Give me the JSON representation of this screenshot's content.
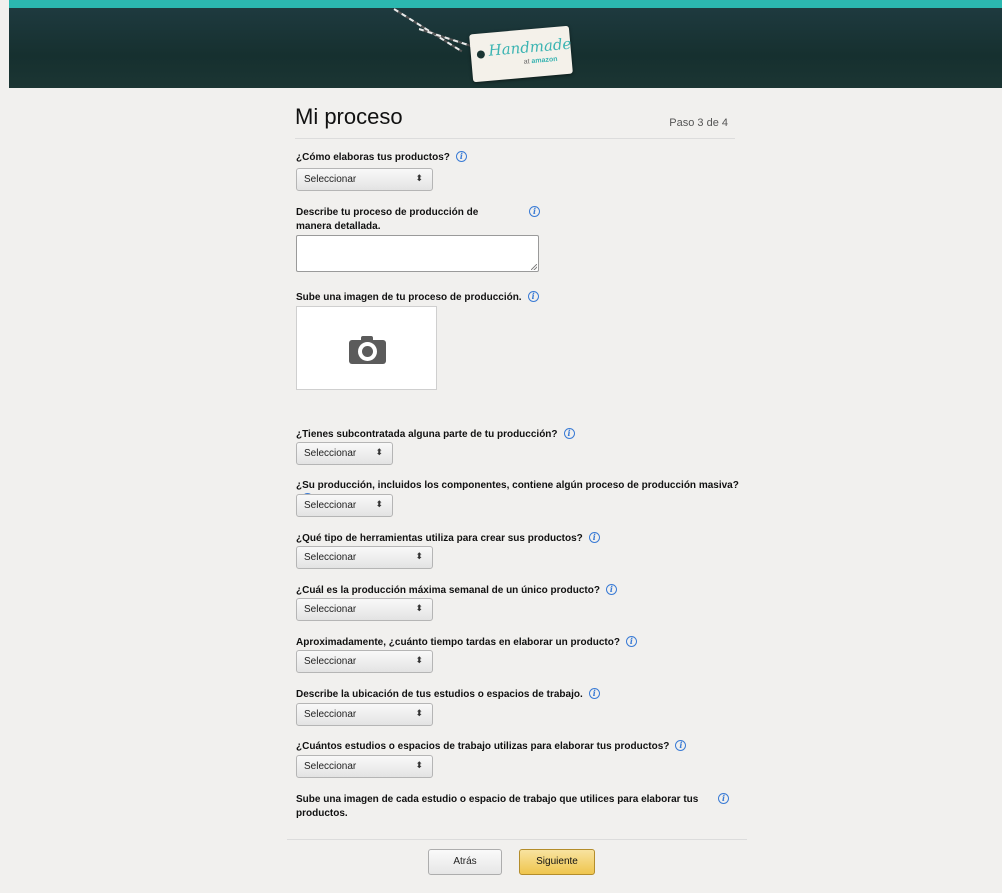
{
  "header": {
    "brand": "Handmade",
    "brand_at": "at",
    "brand_amazon": "amazon"
  },
  "page": {
    "title": "Mi proceso",
    "step": "Paso 3 de 4"
  },
  "questions": {
    "q1": {
      "label": "¿Cómo elaboras tus productos?",
      "select": "Seleccionar"
    },
    "q2": {
      "label": "Describe tu proceso de producción de manera detallada.",
      "value": ""
    },
    "q3": {
      "label": "Sube una imagen de tu proceso de producción."
    },
    "q4": {
      "label": "¿Tienes subcontratada alguna parte de tu producción?",
      "select": "Seleccionar"
    },
    "q5": {
      "label": "¿Su producción, incluidos los componentes, contiene algún proceso de producción masiva?",
      "select": "Seleccionar"
    },
    "q6": {
      "label": "¿Qué tipo de herramientas utiliza para crear sus productos?",
      "select": "Seleccionar"
    },
    "q7": {
      "label": "¿Cuál es la producción máxima semanal de un único producto?",
      "select": "Seleccionar"
    },
    "q8": {
      "label": "Aproximadamente, ¿cuánto tiempo tardas en elaborar un producto?",
      "select": "Seleccionar"
    },
    "q9": {
      "label": "Describe la ubicación de tus estudios o espacios de trabajo.",
      "select": "Seleccionar"
    },
    "q10": {
      "label": "¿Cuántos estudios o espacios de trabajo utilizas para elaborar tus productos?",
      "select": "Seleccionar"
    },
    "q11": {
      "label": "Sube una imagen de cada estudio o espacio de trabajo que utilices para elaborar tus productos."
    }
  },
  "icons": {
    "info": "info-icon",
    "camera": "camera-icon",
    "select_arrow": "updown-arrow-icon"
  },
  "buttons": {
    "back": "Atrás",
    "next": "Siguiente"
  },
  "colors": {
    "accent_teal": "#2bb8b0",
    "primary_button": "#efc54d",
    "info_blue": "#3a7bd5"
  }
}
